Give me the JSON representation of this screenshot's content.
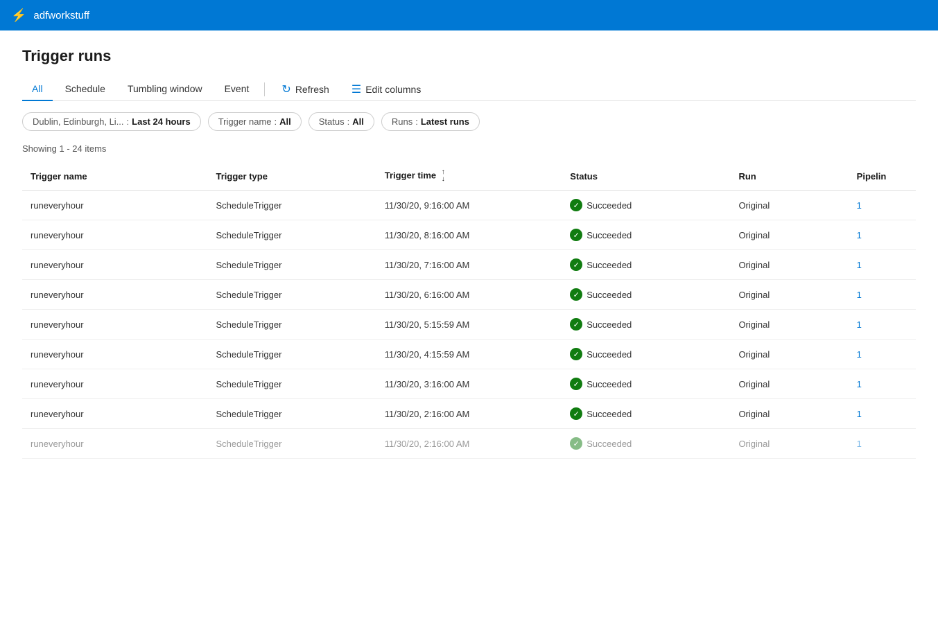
{
  "topbar": {
    "app_name": "adfworkstuff",
    "icon": "⚡"
  },
  "page": {
    "title": "Trigger runs"
  },
  "tabs": {
    "items": [
      {
        "id": "all",
        "label": "All",
        "active": true
      },
      {
        "id": "schedule",
        "label": "Schedule",
        "active": false
      },
      {
        "id": "tumbling-window",
        "label": "Tumbling window",
        "active": false
      },
      {
        "id": "event",
        "label": "Event",
        "active": false
      }
    ]
  },
  "toolbar": {
    "refresh_label": "Refresh",
    "edit_columns_label": "Edit columns"
  },
  "filters": {
    "location": {
      "label": "Dublin, Edinburgh, Li...",
      "separator": " : ",
      "value": "Last 24 hours"
    },
    "trigger_name": {
      "label": "Trigger name",
      "separator": " : ",
      "value": "All"
    },
    "status": {
      "label": "Status",
      "separator": " : ",
      "value": "All"
    },
    "runs": {
      "label": "Runs",
      "separator": " : ",
      "value": "Latest runs"
    }
  },
  "showing_text": "Showing 1 - 24 items",
  "table": {
    "columns": [
      {
        "id": "trigger-name",
        "label": "Trigger name",
        "sortable": false
      },
      {
        "id": "trigger-type",
        "label": "Trigger type",
        "sortable": false
      },
      {
        "id": "trigger-time",
        "label": "Trigger time",
        "sortable": true
      },
      {
        "id": "status",
        "label": "Status",
        "sortable": false
      },
      {
        "id": "run",
        "label": "Run",
        "sortable": false
      },
      {
        "id": "pipeline",
        "label": "Pipelin",
        "sortable": false
      }
    ],
    "rows": [
      {
        "trigger_name": "runeveryhour",
        "trigger_type": "ScheduleTrigger",
        "trigger_time": "11/30/20, 9:16:00 AM",
        "status": "Succeeded",
        "run": "Original",
        "pipeline": "1"
      },
      {
        "trigger_name": "runeveryhour",
        "trigger_type": "ScheduleTrigger",
        "trigger_time": "11/30/20, 8:16:00 AM",
        "status": "Succeeded",
        "run": "Original",
        "pipeline": "1"
      },
      {
        "trigger_name": "runeveryhour",
        "trigger_type": "ScheduleTrigger",
        "trigger_time": "11/30/20, 7:16:00 AM",
        "status": "Succeeded",
        "run": "Original",
        "pipeline": "1"
      },
      {
        "trigger_name": "runeveryhour",
        "trigger_type": "ScheduleTrigger",
        "trigger_time": "11/30/20, 6:16:00 AM",
        "status": "Succeeded",
        "run": "Original",
        "pipeline": "1"
      },
      {
        "trigger_name": "runeveryhour",
        "trigger_type": "ScheduleTrigger",
        "trigger_time": "11/30/20, 5:15:59 AM",
        "status": "Succeeded",
        "run": "Original",
        "pipeline": "1"
      },
      {
        "trigger_name": "runeveryhour",
        "trigger_type": "ScheduleTrigger",
        "trigger_time": "11/30/20, 4:15:59 AM",
        "status": "Succeeded",
        "run": "Original",
        "pipeline": "1"
      },
      {
        "trigger_name": "runeveryhour",
        "trigger_type": "ScheduleTrigger",
        "trigger_time": "11/30/20, 3:16:00 AM",
        "status": "Succeeded",
        "run": "Original",
        "pipeline": "1"
      },
      {
        "trigger_name": "runeveryhour",
        "trigger_type": "ScheduleTrigger",
        "trigger_time": "11/30/20, 2:16:00 AM",
        "status": "Succeeded",
        "run": "Original",
        "pipeline": "1"
      }
    ],
    "partial_row": {
      "trigger_name": "runeveryhour",
      "trigger_type": "ScheduleTrigger",
      "trigger_time": "11/30/20, 2:16:00 AM",
      "status": "Succeeded",
      "run": "Original",
      "pipeline": "1"
    }
  },
  "colors": {
    "accent": "#0078d4",
    "success": "#107c10",
    "header_bg": "#0078d4"
  }
}
